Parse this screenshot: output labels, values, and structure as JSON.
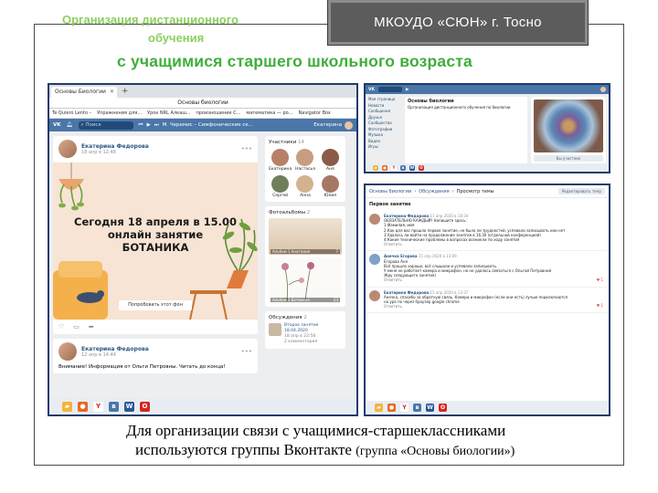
{
  "header": {
    "title_line1": "Организация дистанционного",
    "title_line2": "обучения",
    "org": "МКОУДО «СЮН»  г. Тосно",
    "subtitle": "с учащимися  старшего школьного возраста"
  },
  "caption": {
    "line1": "Для организации связи с учащимися-старшеклассниками",
    "line2_main": "используются группы Вконтакте ",
    "line2_small": "(группа «Основы биологии»)"
  },
  "left": {
    "tab_title": "Основы Биологии",
    "address": "Основы биологии",
    "bookmarks": [
      "Te Quiero Lento –",
      "Упражнения для...",
      "Урок NRL Алкаш...",
      "произношение C...",
      "математика — ро...",
      "Navigator Box"
    ],
    "search_placeholder": "Поиск",
    "player": "М. Черемис – Симфонические ск...",
    "user": "Екатерина",
    "post1": {
      "author": "Екатерина Федорова",
      "date": "18 апр в 12:48",
      "banner_line1": "Сегодня 18 апреля в 15.00",
      "banner_line2": "онлайн занятие",
      "banner_line3": "БОТАНИКА",
      "banner_button": "Попробовать этот фон"
    },
    "post2": {
      "author": "Екатерина Федорова",
      "date": "12 апр в 14:44",
      "text": "Внимание! Информация от Ольги Петровны. Читать до конца!"
    },
    "members": {
      "title": "Участники",
      "count": "14",
      "names": [
        "Екатерина",
        "Настасья",
        "Аня",
        "Сергей",
        "Анна",
        "Юлия"
      ]
    },
    "albums": {
      "title": "Фотоальбомы",
      "count": "2",
      "album1_name": "Альбом 1 Анатомия",
      "album1_count": "7",
      "album2_name": "Альбом 2 Ботаника",
      "album2_count": "23"
    },
    "discussions": {
      "title": "Обсуждения",
      "count": "2",
      "topic": "Второе занятие 18.04.2020",
      "when": "18 апр в 22:58",
      "comments": "2 комментария"
    }
  },
  "right_top": {
    "menu": [
      "Моя страница",
      "Новости",
      "Сообщения",
      "Друзья",
      "Сообщества",
      "Фотографии",
      "Музыка",
      "Видео",
      "Игры"
    ],
    "group_title": "Основы биологии",
    "group_desc": "Организация дистанционного обучения по биологии",
    "follow": "Вы участник"
  },
  "right_bottom": {
    "crumbs": [
      "Основы биологии",
      "Обсуждения",
      "Просмотр темы"
    ],
    "edit_button": "Редактировать тему",
    "topic": "Первое занятие",
    "posts": [
      {
        "name": "Екатерина Федорова",
        "date": "11 апр 2020 в 18:34",
        "lines": [
          "ОБЯЗАТЕЛЬНО КАЖДЫЙ! Напишите здесь:",
          "1.Фамилия, имя",
          "2.Как для вас прошло первое занятие, не было ли трудностей, успевали записывать или нет",
          "3.Удалось ли войти на продолжение занятия в 16.30 (отдельной конференцией)",
          "4.Какие технические проблемы в вопросах возникли по ходу занятия"
        ],
        "reply": "Ответить",
        "likes": ""
      },
      {
        "name": "Анечка Егорова",
        "date": "15 апр 2020 в 13:09",
        "lines": [
          "Егорова Аня",
          "Всё прошло хорошо, всё слышали и успевали записывать.",
          "У меня не работает камера и микрофон, но не удалось связаться с Ольгой Петровной",
          "Жду следующего занятия)"
        ],
        "reply": "Ответить",
        "likes": "1"
      },
      {
        "name": "Екатерина Федорова",
        "date": "15 апр 2020 в 13:37",
        "lines": [
          "Анечка, спасибо за обратную связь. Камера и микрофон (если они есть) лучше подключаются",
          "на ура по через браузер google chrome"
        ],
        "reply": "Ответить",
        "likes": "1"
      }
    ]
  },
  "taskbar_icons": [
    "explorer-icon",
    "firefox-icon",
    "yandex-icon",
    "vk-icon",
    "word-icon",
    "opera-icon"
  ],
  "colors": {
    "title_green": "#8ccf5e",
    "subtitle_green": "#3fae3a",
    "vk_blue": "#4a76a8",
    "frame_border": "#1f3b6a"
  }
}
